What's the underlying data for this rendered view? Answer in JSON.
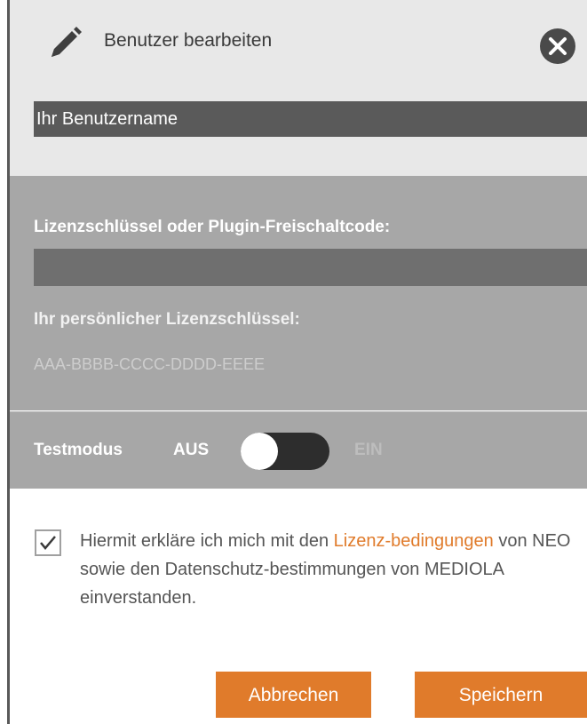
{
  "header": {
    "title": "Benutzer bearbeiten",
    "icon": "pencil-icon",
    "close_icon": "close-icon"
  },
  "username": {
    "value": "Ihr Benutzername"
  },
  "license": {
    "label": "Lizenzschlüssel oder Plugin-Freischaltcode:",
    "input_value": "",
    "personal_label": "Ihr persönlicher Lizenzschlüssel:",
    "personal_value": "AAA-BBBB-CCCC-DDDD-EEEE"
  },
  "test_mode": {
    "label": "Testmodus",
    "off_label": "AUS",
    "on_label": "EIN",
    "state": "off"
  },
  "consent": {
    "checked": true,
    "text_before": "Hiermit erkläre ich mich mit den ",
    "link_text": "Lizenz-bedingungen",
    "text_after": " von NEO sowie den Datenschutz-bestimmungen von MEDIOLA einverstanden."
  },
  "buttons": {
    "cancel_label": "Abbrechen",
    "save_label": "Speichern"
  },
  "colors": {
    "accent": "#e07b2b",
    "header_bg": "#e8e8e8",
    "section_bg": "#a7a7a7",
    "dark_input": "#5a5a5a"
  }
}
